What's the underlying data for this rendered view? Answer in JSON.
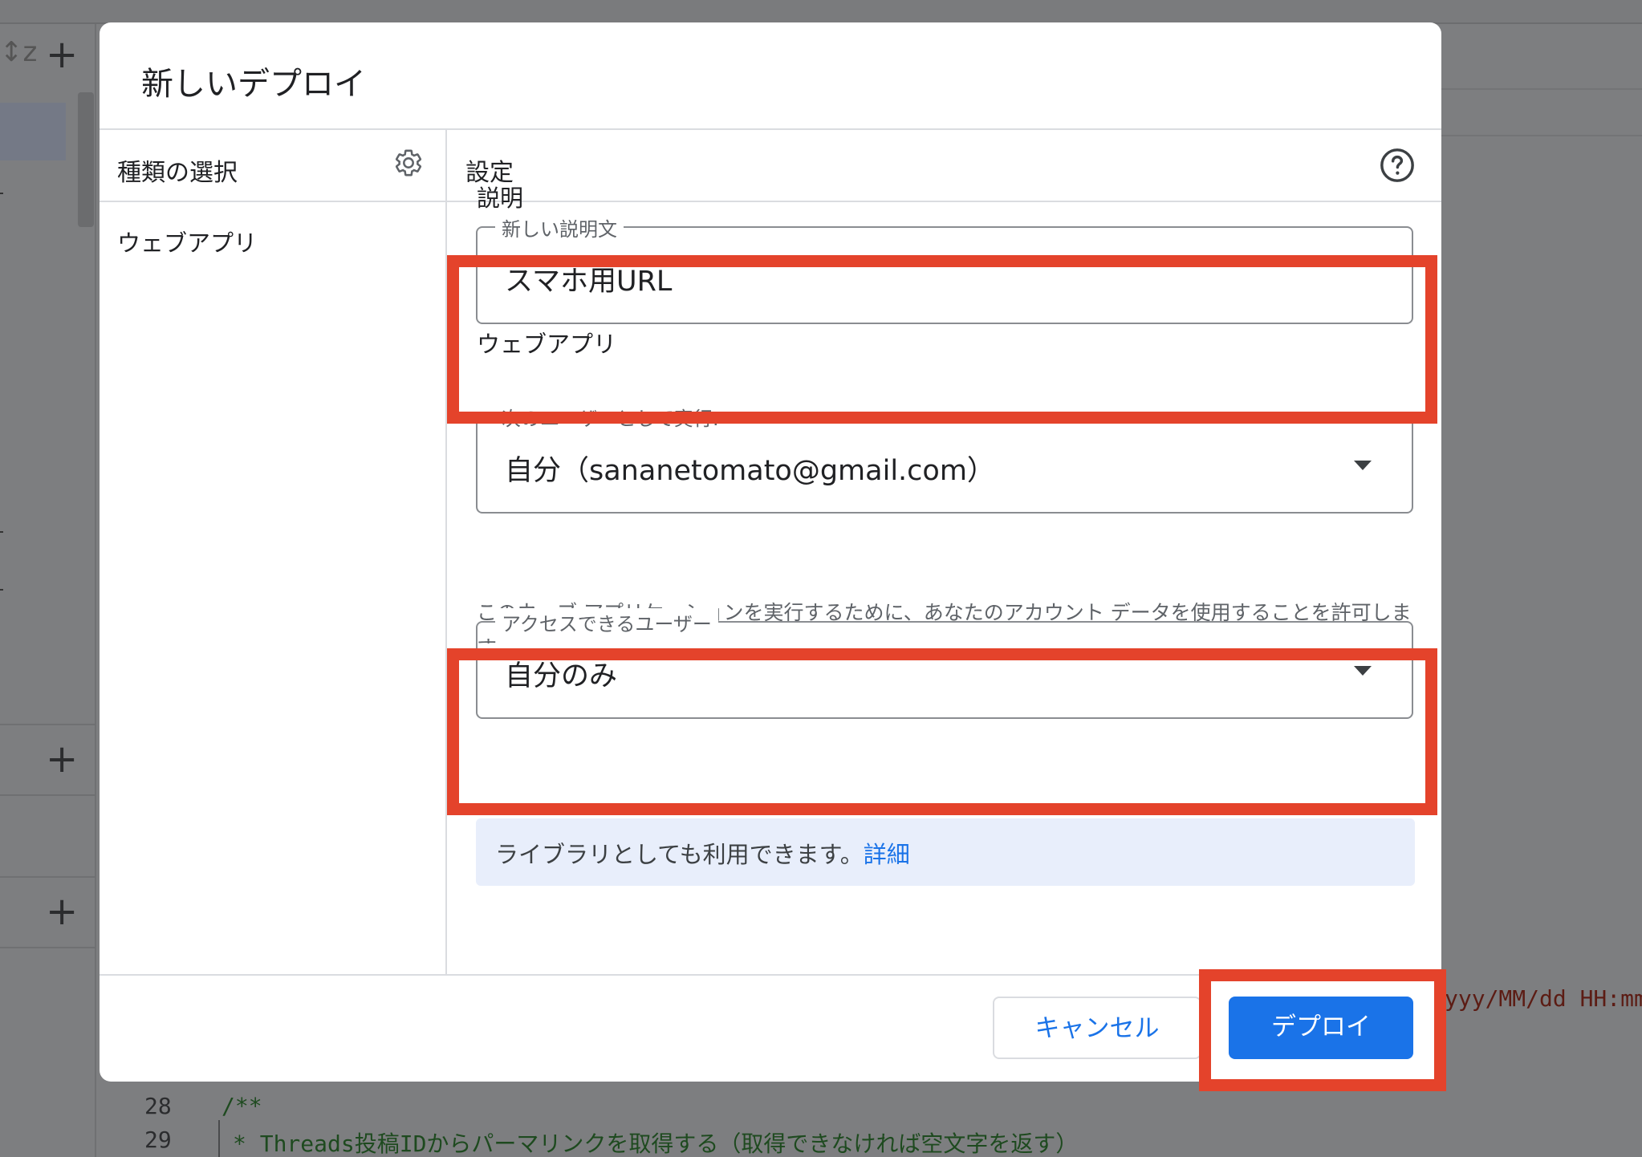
{
  "background": {
    "lines": [
      {
        "number": "28",
        "text": "/**"
      },
      {
        "number": "29",
        "text": "* Threads投稿IDからパーマリンクを取得する（取得できなければ空文字を返す）"
      }
    ],
    "right_code": "yyy/MM/dd HH:mm"
  },
  "dialog": {
    "title": "新しいデプロイ",
    "left": {
      "header": "種類の選択",
      "items": [
        "ウェブアプリ"
      ]
    },
    "right": {
      "header": "設定",
      "description_section": "説明",
      "description_field": {
        "label": "新しい説明文",
        "value": "スマホ用URL"
      },
      "webapp_section": "ウェブアプリ",
      "execute_as": {
        "label": "次のユーザーとして実行:",
        "value": "自分（sananetomato@gmail.com）"
      },
      "execute_help": "このウェブ アプリケーションを実行するために、あなたのアカウント データを使用することを許可します。",
      "access": {
        "label": "アクセスできるユーザー",
        "value": "自分のみ"
      },
      "info": {
        "text": "ライブラリとしても利用できます。",
        "link": "詳細"
      }
    },
    "buttons": {
      "cancel": "キャンセル",
      "deploy": "デプロイ"
    }
  },
  "colors": {
    "primary": "#1a73e8",
    "highlight": "#e4432b",
    "info_bg": "#e8eefb"
  },
  "icons": {
    "settings": "gear-icon",
    "help": "help-circle-icon",
    "dropdown": "caret-down-icon",
    "add": "plus-icon"
  }
}
